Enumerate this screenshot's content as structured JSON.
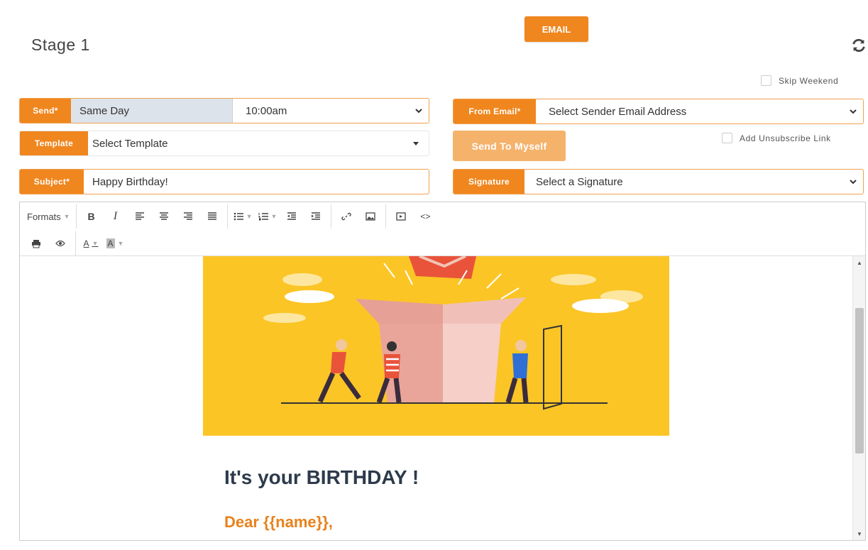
{
  "header": {
    "email_button": "EMAIL",
    "stage_title": "Stage 1"
  },
  "options": {
    "skip_weekend": "Skip Weekend",
    "add_unsubscribe": "Add Unsubscribe Link"
  },
  "form": {
    "send": {
      "label": "Send*",
      "day": "Same Day",
      "time": "10:00am"
    },
    "template": {
      "label": "Template",
      "value": "Select Template"
    },
    "subject": {
      "label": "Subject*",
      "value": "Happy Birthday!"
    },
    "from_email": {
      "label": "From Email*",
      "value": "Select Sender Email Address"
    },
    "send_to_myself": "Send To Myself",
    "signature": {
      "label": "Signature",
      "value": "Select a Signature"
    }
  },
  "toolbar": {
    "formats": "Formats",
    "bold": "B",
    "italic": "I",
    "text_color": "A",
    "bg_color": "A"
  },
  "email_body": {
    "title": "It's your BIRTHDAY !",
    "greeting": "Dear {{name}},"
  },
  "colors": {
    "accent": "#f0861e",
    "accent_light": "#f5b26b",
    "hero_bg": "#fbc526",
    "title": "#2d3a4b"
  }
}
